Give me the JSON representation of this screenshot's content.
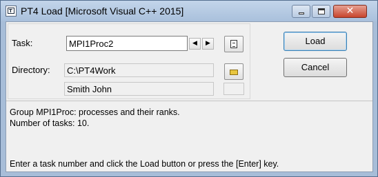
{
  "window": {
    "title": "PT4 Load [Microsoft Visual C++ 2015]",
    "app_icon_text": "T"
  },
  "task": {
    "label": "Task:",
    "value": "MPI1Proc2",
    "prev_glyph": "◀",
    "next_glyph": "▶"
  },
  "directory": {
    "label": "Directory:",
    "value": "C:\\PT4Work"
  },
  "user": {
    "name": "Smith John"
  },
  "buttons": {
    "load": "Load",
    "cancel": "Cancel"
  },
  "info": {
    "group_line": "Group MPI1Proc: processes and their ranks.",
    "tasks_line": "Number of tasks: 10.",
    "hint_line": "Enter a task number and click the Load button or press the [Enter] key."
  },
  "colors": {
    "title_bar": "#a9c0dc",
    "dialog_bg": "#f0f0f0",
    "close_button": "#c7452d",
    "folder_icon": "#e8c63f"
  },
  "icons": {
    "app": "pt4-app-icon",
    "copy": "copy-icon",
    "folder": "folder-icon"
  }
}
